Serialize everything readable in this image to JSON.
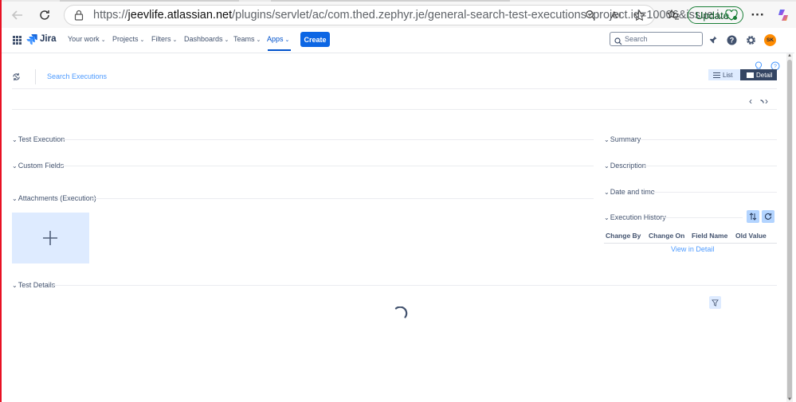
{
  "browser": {
    "url_prefix": "https://",
    "url_host": "jeevlife.atlassian.net",
    "url_rest": "/plugins/servlet/ac/com.thed.zephyr.je/general-search-test-executions?project.id=10006&issue.i...",
    "update_label": "Update",
    "more_label": "···",
    "icons": [
      "back-icon",
      "refresh-icon",
      "lock-icon",
      "zoom-icon",
      "read-aloud-icon",
      "favorite-icon",
      "favorites-bar-icon",
      "more-icon",
      "copilot-icon"
    ]
  },
  "jira": {
    "logo_text": "Jira",
    "nav": {
      "your_work": "Your work",
      "projects": "Projects",
      "filters": "Filters",
      "dashboards": "Dashboards",
      "teams": "Teams",
      "apps": "Apps"
    },
    "create_label": "Create",
    "search_placeholder": "Search",
    "avatar_initials": "SK"
  },
  "toolbar": {
    "search_executions": "Search Executions",
    "list_label": "List",
    "detail_label": "Detail"
  },
  "sections_left": {
    "test_execution": "Test Execution",
    "custom_fields": "Custom Fields",
    "attachments": "Attachments (Execution)",
    "test_details": "Test Details"
  },
  "sections_right": {
    "summary": "Summary",
    "description": "Description",
    "date_time": "Date and time",
    "execution_history": "Execution History"
  },
  "history_table": {
    "headers": [
      "Change By",
      "Change On",
      "Field Name",
      "Old Value"
    ],
    "view_in_detail": "View in Detail"
  },
  "pager": {
    "prev": "‹",
    "next": "›"
  },
  "colors": {
    "accent": "#0c66e4",
    "link": "#4c9aff",
    "attach_bg": "#deebff",
    "detail_bg": "#344563"
  }
}
